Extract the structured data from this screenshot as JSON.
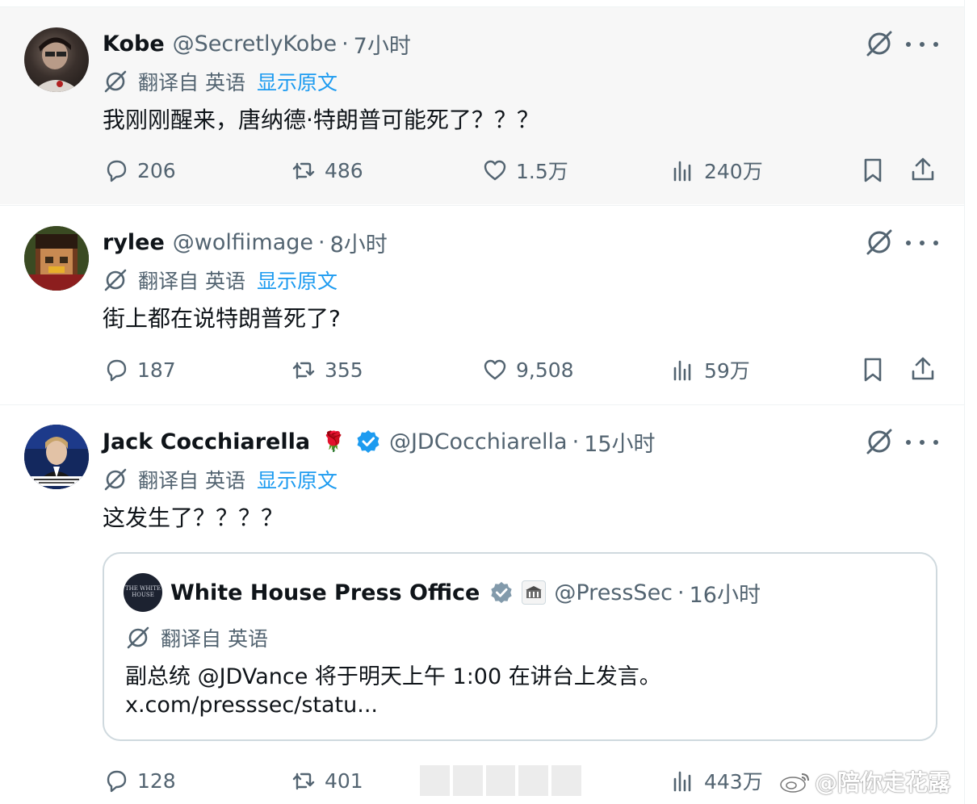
{
  "translate_label": "翻译自 英语",
  "show_original_label": "显示原文",
  "separator": "·",
  "tweets": [
    {
      "name": "Kobe",
      "handle": "@SecretlyKobe",
      "time": "7小时",
      "text": "我刚刚醒来，唐纳德·特朗普可能死了？？？",
      "stats": {
        "replies": "206",
        "retweets": "486",
        "likes": "1.5万",
        "views": "240万"
      }
    },
    {
      "name": "rylee",
      "handle": "@wolfiimage",
      "time": "8小时",
      "text": "街上都在说特朗普死了?",
      "stats": {
        "replies": "187",
        "retweets": "355",
        "likes": "9,508",
        "views": "59万"
      }
    },
    {
      "name": "Jack Cocchiarella",
      "emoji": "🌹",
      "handle": "@JDCocchiarella",
      "time": "15小时",
      "text": "这发生了？？？？",
      "stats": {
        "replies": "128",
        "retweets": "401",
        "likes": "",
        "views": "443万"
      },
      "quote": {
        "name": "White House Press Office",
        "avatar_text": "THE WHITE HOUSE",
        "handle": "@PressSec",
        "time": "16小时",
        "line1": "副总统 @JDVance 将于明天上午 1:00 在讲台上发言。",
        "line2": "x.com/presssec/statu..."
      }
    }
  ],
  "watermark": "@陪你走花露",
  "colors": {
    "accent": "#1d9bf0",
    "muted": "#536471",
    "text": "#0f1419",
    "border": "#eff3f4"
  },
  "icons": [
    "grok-icon",
    "more-icon",
    "translate-icon",
    "reply-icon",
    "retweet-icon",
    "like-icon",
    "views-icon",
    "bookmark-icon",
    "share-icon",
    "verified-icon"
  ]
}
